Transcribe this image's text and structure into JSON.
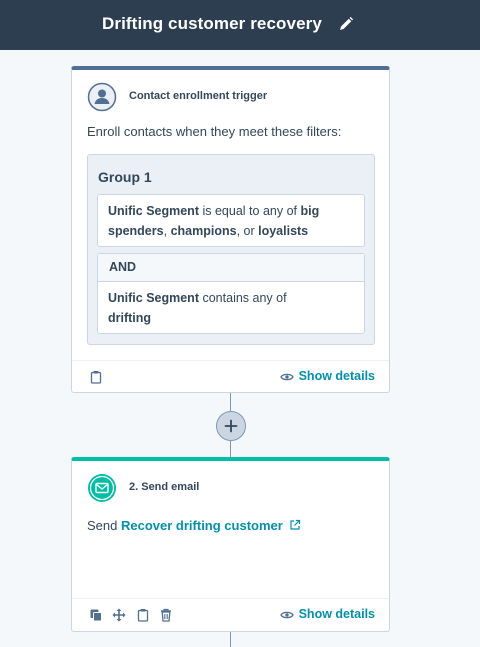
{
  "header": {
    "title": "Drifting customer recovery",
    "edit_icon": "pencil-icon"
  },
  "trigger": {
    "label": "Contact enrollment trigger",
    "icon": "contact-person-icon",
    "lead": "Enroll contacts when they meet these filters:",
    "group_title": "Group 1",
    "filter1": {
      "property": "Unific Segment",
      "operator": "is equal to any of",
      "value1": "big spenders",
      "sep1": ",",
      "value2": "champions",
      "sep2": ", or",
      "value3": "loyalists"
    },
    "and_label": "AND",
    "filter2": {
      "property": "Unific Segment",
      "operator": "contains any of",
      "value": "drifting"
    },
    "show_details": "Show details"
  },
  "action": {
    "label": "2. Send email",
    "icon": "email-icon",
    "send_prefix": "Send",
    "email_name": "Recover drifting customer",
    "show_details": "Show details"
  },
  "colors": {
    "header_bg": "#2d3e50",
    "trigger_accent": "#516f90",
    "action_accent": "#00bda5",
    "link": "#0091ae"
  }
}
